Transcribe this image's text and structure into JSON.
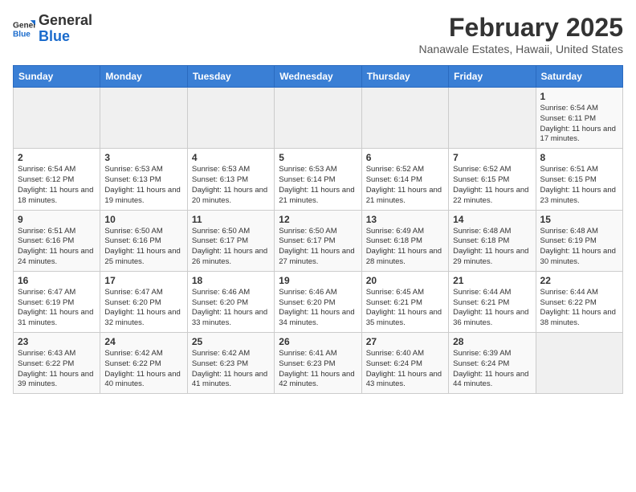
{
  "header": {
    "logo_general": "General",
    "logo_blue": "Blue",
    "main_title": "February 2025",
    "subtitle": "Nanawale Estates, Hawaii, United States"
  },
  "weekdays": [
    "Sunday",
    "Monday",
    "Tuesday",
    "Wednesday",
    "Thursday",
    "Friday",
    "Saturday"
  ],
  "weeks": [
    [
      null,
      null,
      null,
      null,
      null,
      null,
      {
        "day": 1,
        "sunrise": "6:54 AM",
        "sunset": "6:11 PM",
        "daylight": "11 hours and 17 minutes."
      }
    ],
    [
      {
        "day": 2,
        "sunrise": "6:54 AM",
        "sunset": "6:12 PM",
        "daylight": "11 hours and 18 minutes."
      },
      {
        "day": 3,
        "sunrise": "6:53 AM",
        "sunset": "6:13 PM",
        "daylight": "11 hours and 19 minutes."
      },
      {
        "day": 4,
        "sunrise": "6:53 AM",
        "sunset": "6:13 PM",
        "daylight": "11 hours and 20 minutes."
      },
      {
        "day": 5,
        "sunrise": "6:53 AM",
        "sunset": "6:14 PM",
        "daylight": "11 hours and 21 minutes."
      },
      {
        "day": 6,
        "sunrise": "6:52 AM",
        "sunset": "6:14 PM",
        "daylight": "11 hours and 21 minutes."
      },
      {
        "day": 7,
        "sunrise": "6:52 AM",
        "sunset": "6:15 PM",
        "daylight": "11 hours and 22 minutes."
      },
      {
        "day": 8,
        "sunrise": "6:51 AM",
        "sunset": "6:15 PM",
        "daylight": "11 hours and 23 minutes."
      }
    ],
    [
      {
        "day": 9,
        "sunrise": "6:51 AM",
        "sunset": "6:16 PM",
        "daylight": "11 hours and 24 minutes."
      },
      {
        "day": 10,
        "sunrise": "6:50 AM",
        "sunset": "6:16 PM",
        "daylight": "11 hours and 25 minutes."
      },
      {
        "day": 11,
        "sunrise": "6:50 AM",
        "sunset": "6:17 PM",
        "daylight": "11 hours and 26 minutes."
      },
      {
        "day": 12,
        "sunrise": "6:50 AM",
        "sunset": "6:17 PM",
        "daylight": "11 hours and 27 minutes."
      },
      {
        "day": 13,
        "sunrise": "6:49 AM",
        "sunset": "6:18 PM",
        "daylight": "11 hours and 28 minutes."
      },
      {
        "day": 14,
        "sunrise": "6:48 AM",
        "sunset": "6:18 PM",
        "daylight": "11 hours and 29 minutes."
      },
      {
        "day": 15,
        "sunrise": "6:48 AM",
        "sunset": "6:19 PM",
        "daylight": "11 hours and 30 minutes."
      }
    ],
    [
      {
        "day": 16,
        "sunrise": "6:47 AM",
        "sunset": "6:19 PM",
        "daylight": "11 hours and 31 minutes."
      },
      {
        "day": 17,
        "sunrise": "6:47 AM",
        "sunset": "6:20 PM",
        "daylight": "11 hours and 32 minutes."
      },
      {
        "day": 18,
        "sunrise": "6:46 AM",
        "sunset": "6:20 PM",
        "daylight": "11 hours and 33 minutes."
      },
      {
        "day": 19,
        "sunrise": "6:46 AM",
        "sunset": "6:20 PM",
        "daylight": "11 hours and 34 minutes."
      },
      {
        "day": 20,
        "sunrise": "6:45 AM",
        "sunset": "6:21 PM",
        "daylight": "11 hours and 35 minutes."
      },
      {
        "day": 21,
        "sunrise": "6:44 AM",
        "sunset": "6:21 PM",
        "daylight": "11 hours and 36 minutes."
      },
      {
        "day": 22,
        "sunrise": "6:44 AM",
        "sunset": "6:22 PM",
        "daylight": "11 hours and 38 minutes."
      }
    ],
    [
      {
        "day": 23,
        "sunrise": "6:43 AM",
        "sunset": "6:22 PM",
        "daylight": "11 hours and 39 minutes."
      },
      {
        "day": 24,
        "sunrise": "6:42 AM",
        "sunset": "6:22 PM",
        "daylight": "11 hours and 40 minutes."
      },
      {
        "day": 25,
        "sunrise": "6:42 AM",
        "sunset": "6:23 PM",
        "daylight": "11 hours and 41 minutes."
      },
      {
        "day": 26,
        "sunrise": "6:41 AM",
        "sunset": "6:23 PM",
        "daylight": "11 hours and 42 minutes."
      },
      {
        "day": 27,
        "sunrise": "6:40 AM",
        "sunset": "6:24 PM",
        "daylight": "11 hours and 43 minutes."
      },
      {
        "day": 28,
        "sunrise": "6:39 AM",
        "sunset": "6:24 PM",
        "daylight": "11 hours and 44 minutes."
      },
      null
    ]
  ]
}
